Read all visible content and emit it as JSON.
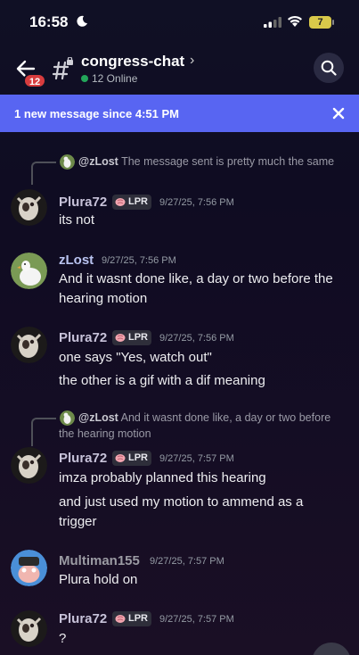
{
  "status_bar": {
    "time": "16:58",
    "battery": "7"
  },
  "header": {
    "back_badge": "12",
    "channel_name": "congress-chat",
    "online_count": "12 Online"
  },
  "banner": {
    "text": "1 new message since 4:51 PM"
  },
  "messages": [
    {
      "reply": {
        "author": "@zLost",
        "text": "The message sent is pretty much the same"
      },
      "author": "Plura72",
      "tag": "LPR",
      "time": "9/27/25, 7:56 PM",
      "lines": [
        "its not"
      ]
    },
    {
      "author": "zLost",
      "time": "9/27/25, 7:56 PM",
      "lines": [
        "And it wasnt done like, a day or two before the hearing motion"
      ]
    },
    {
      "author": "Plura72",
      "tag": "LPR",
      "time": "9/27/25, 7:56 PM",
      "lines": [
        "one says \"Yes, watch out\"",
        "the other is a gif with a dif meaning"
      ]
    },
    {
      "reply": {
        "author": "@zLost",
        "text": "And it wasnt done like, a day or two before the hearing motion"
      },
      "author": "Plura72",
      "tag": "LPR",
      "time": "9/27/25, 7:57 PM",
      "lines": [
        "imza probably planned this hearing",
        "and just used my motion to ammend as a trigger"
      ]
    },
    {
      "author": "Multiman155",
      "time": "9/27/25, 7:57 PM",
      "lines": [
        "Plura hold on"
      ]
    },
    {
      "author": "Plura72",
      "tag": "LPR",
      "time": "9/27/25, 7:57 PM",
      "lines": [
        "?"
      ]
    }
  ],
  "colors": {
    "accent": "#5865f2",
    "plura_name": "#c7c2d9",
    "zlost_name": "#b9c3f0",
    "multiman_name": "#9b9ba3",
    "online": "#23a55a",
    "badge": "#d83c3e"
  },
  "icons": [
    "moon-icon",
    "signal-icon",
    "wifi-icon",
    "back-arrow-icon",
    "hash-lock-icon",
    "search-icon",
    "close-icon",
    "brain-icon"
  ]
}
